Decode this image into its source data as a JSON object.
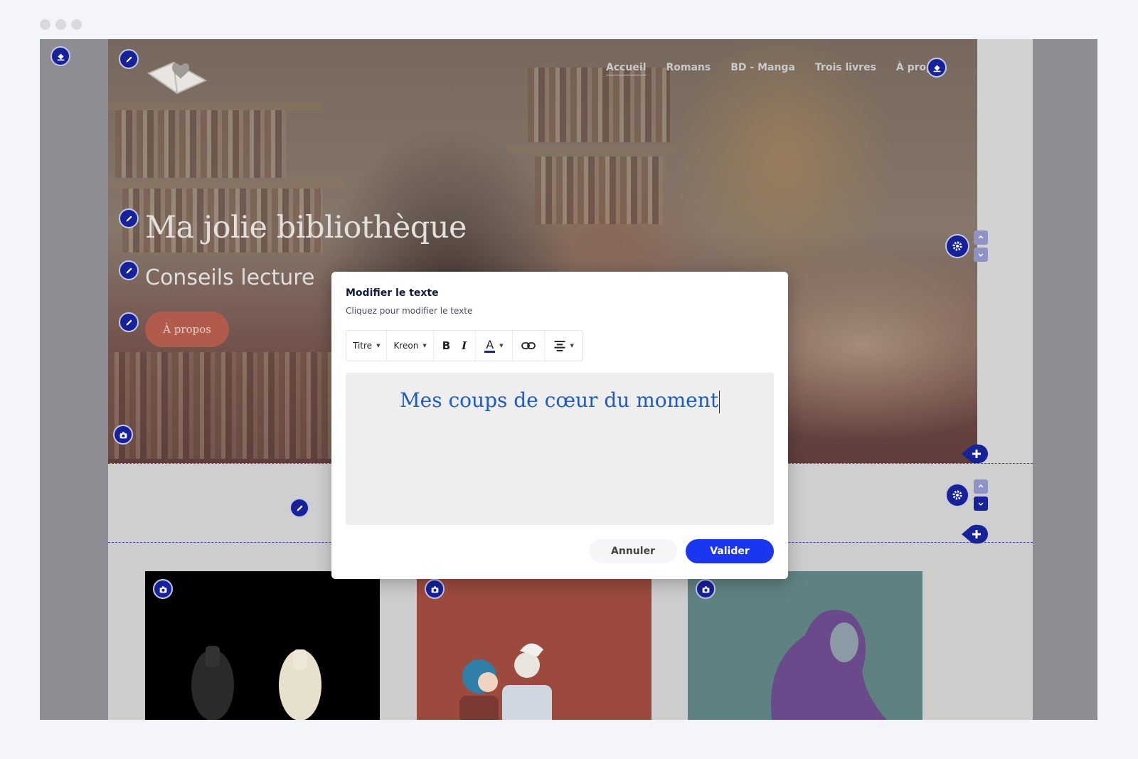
{
  "site": {
    "nav": [
      "Accueil",
      "Romans",
      "BD - Manga",
      "Trois livres",
      "À propos"
    ],
    "hero_title": "Ma jolie bibliothèque",
    "hero_subtitle": "Conseils lecture",
    "hero_button": "À propos"
  },
  "modal": {
    "title": "Modifier le texte",
    "subtitle": "Cliquez pour modifier le texte",
    "toolbar": {
      "style_select": "Titre",
      "font_select": "Kreon",
      "bold": "B",
      "italic": "I",
      "color": "A"
    },
    "editor_text": "Mes coups de cœur du moment",
    "cancel_label": "Annuler",
    "confirm_label": "Valider"
  },
  "colors": {
    "accent": "#1a36f0",
    "editor_blue": "#17219a",
    "hero_button": "#b05b4c"
  },
  "icons": [
    "paint-bucket-icon",
    "pencil-icon",
    "camera-icon",
    "gear-icon",
    "chevron-up-icon",
    "chevron-down-icon",
    "plus-icon",
    "link-icon",
    "align-center-icon"
  ]
}
